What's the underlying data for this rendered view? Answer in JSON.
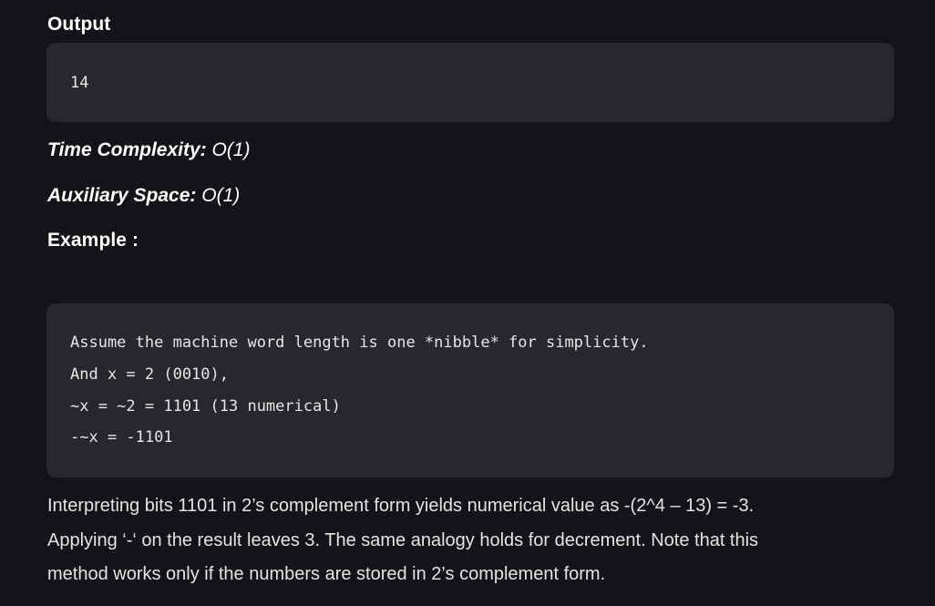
{
  "output_heading": "Output",
  "output_code": "14",
  "time_complexity": {
    "label": "Time Complexity:",
    "value": "O(1)"
  },
  "auxiliary_space": {
    "label": "Auxiliary Space:",
    "value": "O(1)"
  },
  "example_heading": "Example :",
  "example_code": [
    "Assume the machine word length is one *nibble* for simplicity.",
    "And x = 2 (0010),",
    "~x = ~2 = 1101 (13 numerical)",
    "-~x = -1101"
  ],
  "explanation": [
    "Interpreting bits 1101 in 2’s complement form yields numerical value as -(2^4 – 13) = -3.",
    "Applying ‘-‘ on the result leaves 3. The same analogy holds for decrement. Note that this",
    "method works only if the numbers are stored in 2’s complement form."
  ]
}
